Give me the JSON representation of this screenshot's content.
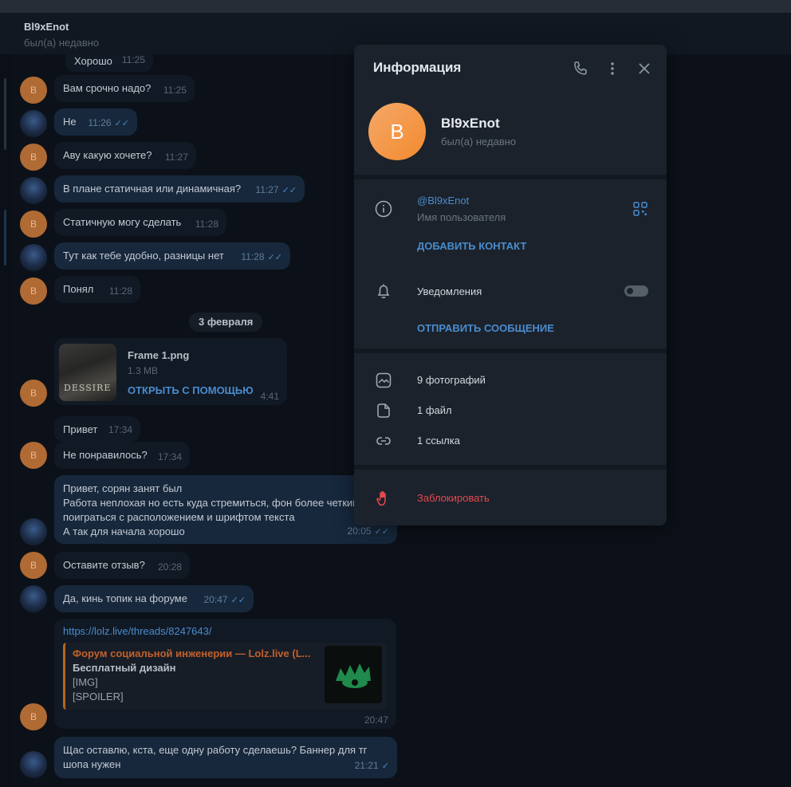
{
  "header": {
    "name": "Bl9xEnot",
    "status": "был(а) недавно"
  },
  "messages": [
    {
      "text": "Хорошо",
      "time": "11:25"
    },
    {
      "text": "Вам срочно надо?",
      "time": "11:25",
      "avatar": "B"
    },
    {
      "text": "Не",
      "time": "11:26"
    },
    {
      "text": "Аву какую хочете?",
      "time": "11:27",
      "avatar": "B"
    },
    {
      "text": "В плане статичная или динамичная?",
      "time": "11:27"
    },
    {
      "text": "Статичную могу сделать",
      "time": "11:28",
      "avatar": "B"
    },
    {
      "text": "Тут как тебе удобно, разницы нет",
      "time": "11:28"
    },
    {
      "text": "Понял",
      "time": "11:28",
      "avatar": "B"
    },
    {
      "text": "Привет",
      "time": "17:34"
    },
    {
      "text": "Не понравилось?",
      "time": "17:34",
      "avatar": "B"
    },
    {
      "text": "Оставите отзыв?",
      "time": "20:28",
      "avatar": "B"
    },
    {
      "text": "Да, кинь топик на форуме",
      "time": "20:47"
    }
  ],
  "long_message": {
    "lines": [
      "Привет, сорян занят был",
      "Работа неплохая но есть куда стремиться, фон более четкий",
      "поиграться с расположением и шрифтом текста",
      "А так для начала хорошо"
    ],
    "time": "20:05"
  },
  "last_message": {
    "lines": [
      "Щас оставлю, кста, еще одну работу сделаешь? Баннер для тг",
      "шопа нужен"
    ],
    "time": "21:21"
  },
  "date_divider": "3 февраля",
  "file_msg": {
    "name": "Frame 1.png",
    "size": "1.3 MB",
    "open": "ОТКРЫТЬ С ПОМОЩЬЮ",
    "time": "4:41",
    "thumb_text": "DESSIRE"
  },
  "link_msg": {
    "url": "https://lolz.live/threads/8247643/",
    "preview_title": "Форум социальной инженерии — Lolz.live (L...",
    "preview_subtitle": "Бесплатный дизайн",
    "preview_lines": [
      "[IMG]",
      "[SPOILER]"
    ],
    "time": "20:47"
  },
  "panel": {
    "title": "Информация",
    "avatar_letter": "B",
    "name": "Bl9xEnot",
    "status": "был(а) недавно",
    "username": "@Bl9xEnot",
    "username_label": "Имя пользователя",
    "add_contact": "ДОБАВИТЬ КОНТАКТ",
    "notifications": "Уведомления",
    "notifications_on": false,
    "send_message": "ОТПРАВИТЬ СООБЩЕНИЕ",
    "photos": "9 фотографий",
    "files": "1 файл",
    "links": "1 ссылка",
    "block": "Заблокировать"
  },
  "colors": {
    "accent": "#4a8ccd",
    "danger": "#e5484d",
    "avatar_orange": "#f28a2e"
  }
}
